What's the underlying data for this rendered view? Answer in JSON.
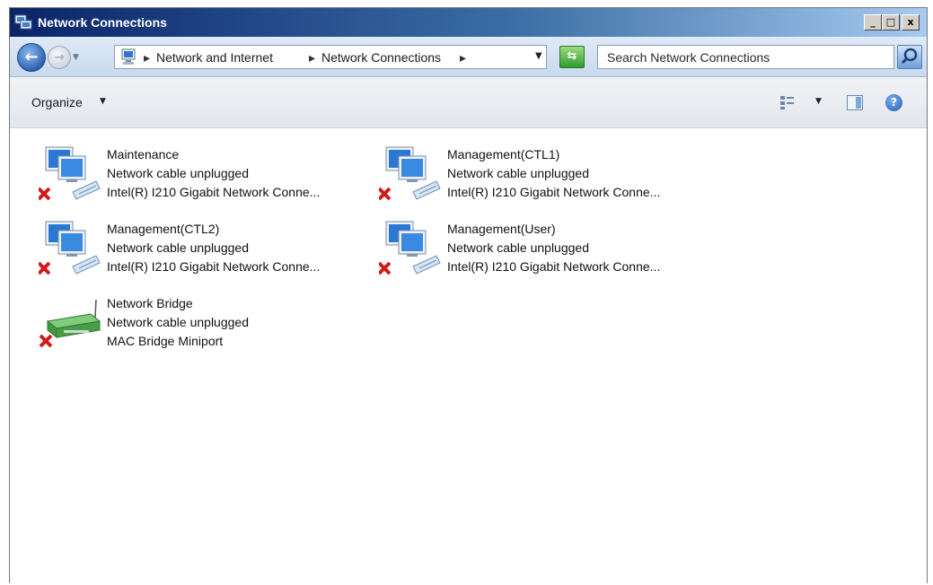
{
  "window": {
    "title": "Network Connections",
    "controls": {
      "minimize": "_",
      "maximize": "□",
      "close": "x"
    }
  },
  "address_bar": {
    "separator": "▸",
    "breadcrumbs": [
      "Network and Internet",
      "Network Connections"
    ],
    "search_placeholder": "Search Network Connections"
  },
  "toolbar": {
    "organize_label": "Organize",
    "icons": [
      "change-view-icon",
      "preview-pane-icon",
      "help-icon"
    ]
  },
  "connections": [
    {
      "name": "Maintenance",
      "status": "Network cable unplugged",
      "device": "Intel(R) I210 Gigabit Network Conne...",
      "icon": "network-adapter-disconnected-icon"
    },
    {
      "name": "Management(CTL1)",
      "status": "Network cable unplugged",
      "device": "Intel(R) I210 Gigabit Network Conne...",
      "icon": "network-adapter-disconnected-icon"
    },
    {
      "name": "Management(CTL2)",
      "status": "Network cable unplugged",
      "device": "Intel(R) I210 Gigabit Network Conne...",
      "icon": "network-adapter-disconnected-icon"
    },
    {
      "name": "Management(User)",
      "status": "Network cable unplugged",
      "device": "Intel(R) I210 Gigabit Network Conne...",
      "icon": "network-adapter-disconnected-icon"
    },
    {
      "name": "Network Bridge",
      "status": "Network cable unplugged",
      "device": "MAC Bridge Miniport",
      "icon": "network-bridge-disconnected-icon"
    }
  ],
  "colors": {
    "title_bar": "#0a246a",
    "error_x": "#d11b1b",
    "address_bar_bg": "#dfeaf7",
    "bridge_green": "#4a9c4a"
  }
}
